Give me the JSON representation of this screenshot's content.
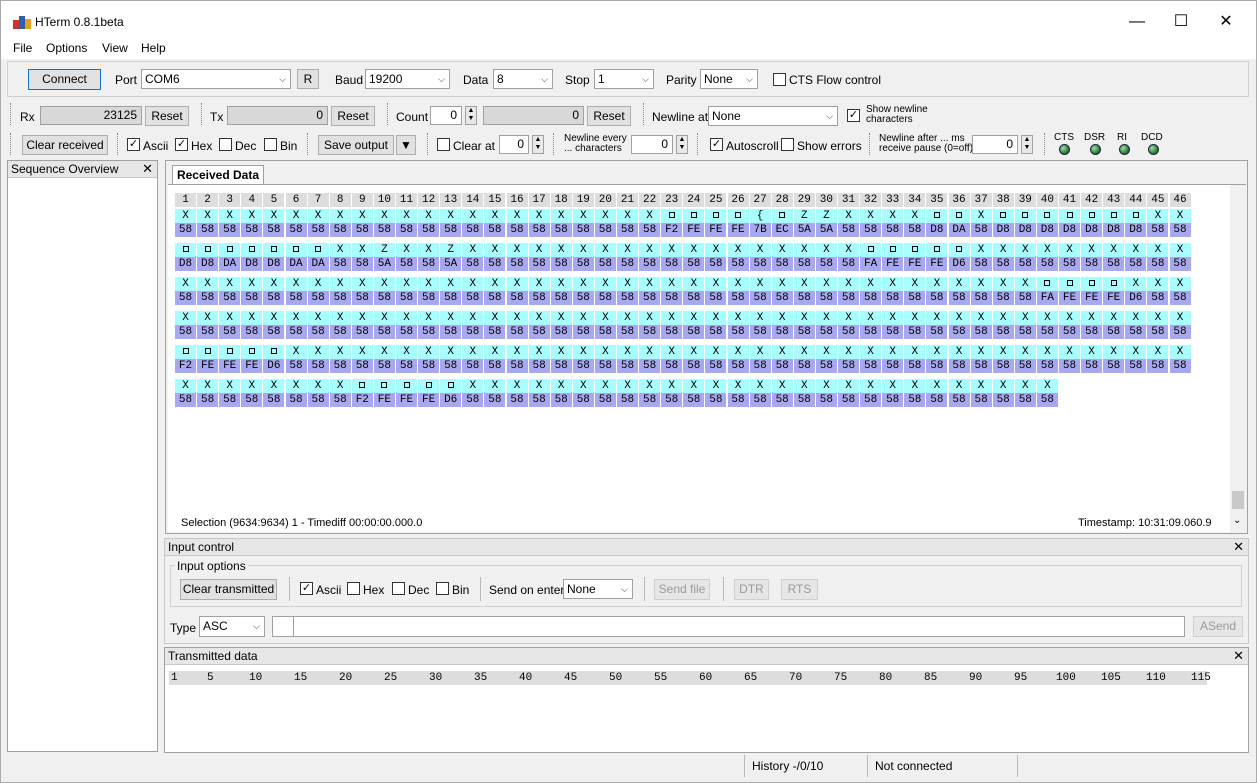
{
  "window": {
    "title": "HTerm 0.8.1beta"
  },
  "menu": [
    "File",
    "Options",
    "View",
    "Help"
  ],
  "conn": {
    "connect": "Connect",
    "port_label": "Port",
    "port": "COM6",
    "r": "R",
    "baud_label": "Baud",
    "baud": "19200",
    "data_label": "Data",
    "data": "8",
    "stop_label": "Stop",
    "stop": "1",
    "parity_label": "Parity",
    "parity": "None",
    "cts": "CTS Flow control"
  },
  "counters": {
    "rx_label": "Rx",
    "rx": "23125",
    "reset": "Reset",
    "tx_label": "Tx",
    "tx": "0",
    "count_label": "Count",
    "count": "0",
    "count_val": "0",
    "newline_label": "Newline at",
    "newline": "None",
    "show_newline": "Show newline characters"
  },
  "rxopts": {
    "clear": "Clear received",
    "ascii": "Ascii",
    "hex": "Hex",
    "dec": "Dec",
    "bin": "Bin",
    "save": "Save output",
    "clear_at": "Clear at",
    "clear_at_val": "0",
    "newline_every": "Newline every ... characters",
    "newline_every_val": "0",
    "autoscroll": "Autoscroll",
    "show_errors": "Show errors",
    "newline_after": "Newline after ... ms receive pause (0=off)",
    "newline_after_val": "0",
    "cts": "CTS",
    "dsr": "DSR",
    "ri": "RI",
    "dcd": "DCD"
  },
  "sidebar": {
    "title": "Sequence Overview"
  },
  "received": {
    "tab": "Received Data",
    "rows": [
      [
        "X",
        "X",
        "X",
        "X",
        "X",
        "X",
        "X",
        "X",
        "X",
        "X",
        "X",
        "X",
        "X",
        "X",
        "X",
        "X",
        "X",
        "X",
        "X",
        "X",
        "X",
        "X",
        "□",
        "□",
        "□",
        "□",
        "{",
        "□",
        "Z",
        "Z",
        "X",
        "X",
        "X",
        "X",
        "□",
        "□",
        "X",
        "□",
        "□",
        "□",
        "□",
        "□",
        "□",
        "□",
        "X",
        "X"
      ],
      [
        "□",
        "□",
        "□",
        "□",
        "□",
        "□",
        "□",
        "X",
        "X",
        "Z",
        "X",
        "X",
        "Z",
        "X",
        "X",
        "X",
        "X",
        "X",
        "X",
        "X",
        "X",
        "X",
        "X",
        "X",
        "X",
        "X",
        "X",
        "X",
        "X",
        "X",
        "X",
        "□",
        "□",
        "□",
        "□",
        "□",
        "X",
        "X",
        "X",
        "X",
        "X",
        "X",
        "X",
        "X",
        "X",
        "X"
      ],
      [
        "X",
        "X",
        "X",
        "X",
        "X",
        "X",
        "X",
        "X",
        "X",
        "X",
        "X",
        "X",
        "X",
        "X",
        "X",
        "X",
        "X",
        "X",
        "X",
        "X",
        "X",
        "X",
        "X",
        "X",
        "X",
        "X",
        "X",
        "X",
        "X",
        "X",
        "X",
        "X",
        "X",
        "X",
        "X",
        "X",
        "X",
        "X",
        "X",
        "□",
        "□",
        "□",
        "□",
        "X",
        "X",
        "X"
      ],
      [
        "X",
        "X",
        "X",
        "X",
        "X",
        "X",
        "X",
        "X",
        "X",
        "X",
        "X",
        "X",
        "X",
        "X",
        "X",
        "X",
        "X",
        "X",
        "X",
        "X",
        "X",
        "X",
        "X",
        "X",
        "X",
        "X",
        "X",
        "X",
        "X",
        "X",
        "X",
        "X",
        "X",
        "X",
        "X",
        "X",
        "X",
        "X",
        "X",
        "X",
        "X",
        "X",
        "X",
        "X",
        "X",
        "X"
      ],
      [
        "□",
        "□",
        "□",
        "□",
        "□",
        "X",
        "X",
        "X",
        "X",
        "X",
        "X",
        "X",
        "X",
        "X",
        "X",
        "X",
        "X",
        "X",
        "X",
        "X",
        "X",
        "X",
        "X",
        "X",
        "X",
        "X",
        "X",
        "X",
        "X",
        "X",
        "X",
        "X",
        "X",
        "X",
        "X",
        "X",
        "X",
        "X",
        "X",
        "X",
        "X",
        "X",
        "X",
        "X",
        "X",
        "X"
      ],
      [
        "X",
        "X",
        "X",
        "X",
        "X",
        "X",
        "X",
        "X",
        "□",
        "□",
        "□",
        "□",
        "□",
        "X",
        "X",
        "X",
        "X",
        "X",
        "X",
        "X",
        "X",
        "X",
        "X",
        "X",
        "X",
        "X",
        "X",
        "X",
        "X",
        "X",
        "X",
        "X",
        "X",
        "X",
        "X",
        "X",
        "X",
        "X",
        "X",
        "X"
      ]
    ],
    "hex": [
      [
        "58",
        "58",
        "58",
        "58",
        "58",
        "58",
        "58",
        "58",
        "58",
        "58",
        "58",
        "58",
        "58",
        "58",
        "58",
        "58",
        "58",
        "58",
        "58",
        "58",
        "58",
        "58",
        "F2",
        "FE",
        "FE",
        "FE",
        "7B",
        "EC",
        "5A",
        "5A",
        "58",
        "58",
        "58",
        "58",
        "D8",
        "DA",
        "58",
        "D8",
        "D8",
        "D8",
        "D8",
        "D8",
        "D8",
        "D8",
        "58",
        "58"
      ],
      [
        "D8",
        "D8",
        "DA",
        "D8",
        "D8",
        "DA",
        "DA",
        "58",
        "58",
        "5A",
        "58",
        "58",
        "5A",
        "58",
        "58",
        "58",
        "58",
        "58",
        "58",
        "58",
        "58",
        "58",
        "58",
        "58",
        "58",
        "58",
        "58",
        "58",
        "58",
        "58",
        "58",
        "FA",
        "FE",
        "FE",
        "FE",
        "D6",
        "58",
        "58",
        "58",
        "58",
        "58",
        "58",
        "58",
        "58",
        "58",
        "58"
      ],
      [
        "58",
        "58",
        "58",
        "58",
        "58",
        "58",
        "58",
        "58",
        "58",
        "58",
        "58",
        "58",
        "58",
        "58",
        "58",
        "58",
        "58",
        "58",
        "58",
        "58",
        "58",
        "58",
        "58",
        "58",
        "58",
        "58",
        "58",
        "58",
        "58",
        "58",
        "58",
        "58",
        "58",
        "58",
        "58",
        "58",
        "58",
        "58",
        "58",
        "FA",
        "FE",
        "FE",
        "FE",
        "D6",
        "58",
        "58"
      ],
      [
        "58",
        "58",
        "58",
        "58",
        "58",
        "58",
        "58",
        "58",
        "58",
        "58",
        "58",
        "58",
        "58",
        "58",
        "58",
        "58",
        "58",
        "58",
        "58",
        "58",
        "58",
        "58",
        "58",
        "58",
        "58",
        "58",
        "58",
        "58",
        "58",
        "58",
        "58",
        "58",
        "58",
        "58",
        "58",
        "58",
        "58",
        "58",
        "58",
        "58",
        "58",
        "58",
        "58",
        "58",
        "58",
        "58"
      ],
      [
        "F2",
        "FE",
        "FE",
        "FE",
        "D6",
        "58",
        "58",
        "58",
        "58",
        "58",
        "58",
        "58",
        "58",
        "58",
        "58",
        "58",
        "58",
        "58",
        "58",
        "58",
        "58",
        "58",
        "58",
        "58",
        "58",
        "58",
        "58",
        "58",
        "58",
        "58",
        "58",
        "58",
        "58",
        "58",
        "58",
        "58",
        "58",
        "58",
        "58",
        "58",
        "58",
        "58",
        "58",
        "58",
        "58",
        "58"
      ],
      [
        "58",
        "58",
        "58",
        "58",
        "58",
        "58",
        "58",
        "58",
        "F2",
        "FE",
        "FE",
        "FE",
        "D6",
        "58",
        "58",
        "58",
        "58",
        "58",
        "58",
        "58",
        "58",
        "58",
        "58",
        "58",
        "58",
        "58",
        "58",
        "58",
        "58",
        "58",
        "58",
        "58",
        "58",
        "58",
        "58",
        "58",
        "58",
        "58",
        "58",
        "58"
      ]
    ],
    "selection": "Selection (9634:9634) 1  -  Timediff 00:00:00.000.0",
    "timestamp": "Timestamp: 10:31:09.060.9"
  },
  "input": {
    "title": "Input control",
    "options": "Input options",
    "clear": "Clear transmitted",
    "ascii": "Ascii",
    "hex": "Hex",
    "dec": "Dec",
    "bin": "Bin",
    "send_on_enter": "Send on enter",
    "send_on_enter_val": "None",
    "send_file": "Send file",
    "dtr": "DTR",
    "rts": "RTS",
    "type_label": "Type",
    "type_val": "ASC",
    "asend": "ASend"
  },
  "transmitted": {
    "title": "Transmitted data",
    "ticks": [
      "1",
      "5",
      "10",
      "15",
      "20",
      "25",
      "30",
      "35",
      "40",
      "45",
      "50",
      "55",
      "60",
      "65",
      "70",
      "75",
      "80",
      "85",
      "90",
      "95",
      "100",
      "105",
      "110",
      "115"
    ]
  },
  "status": {
    "history": "History -/0/10",
    "connection": "Not connected"
  }
}
